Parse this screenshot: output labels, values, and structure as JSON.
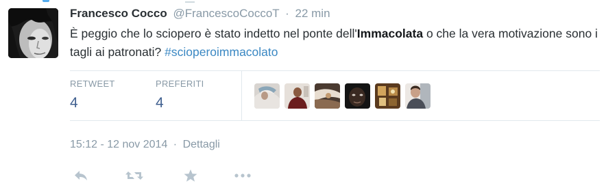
{
  "tweet": {
    "fullname": "Francesco Cocco",
    "username": "@FrancescoCoccoT",
    "separator": "·",
    "time": "22 min",
    "text_before": "È peggio che lo sciopero è stato indetto nel ponte dell'",
    "text_bold": "Immacolata",
    "text_after": " o che la vera motivazione sono i tagli ai patronati? ",
    "hashtag": "#scioperoimmacolato"
  },
  "stats": {
    "retweet_label": "RETWEET",
    "retweet_count": "4",
    "favorites_label": "PREFERITI",
    "favorites_count": "4"
  },
  "meta": {
    "timestamp": "15:12 - 12 nov 2014",
    "separator": "·",
    "details_link": "Dettagli"
  },
  "actions": [
    "reply-icon",
    "retweet-icon",
    "favorite-icon",
    "more-icon"
  ],
  "colors": {
    "link": "#3b88c3",
    "muted": "#8899a6",
    "text": "#292f33",
    "count": "#3f5f8f",
    "divider": "#e1e8ed",
    "action_icon": "#b7c4ce"
  }
}
